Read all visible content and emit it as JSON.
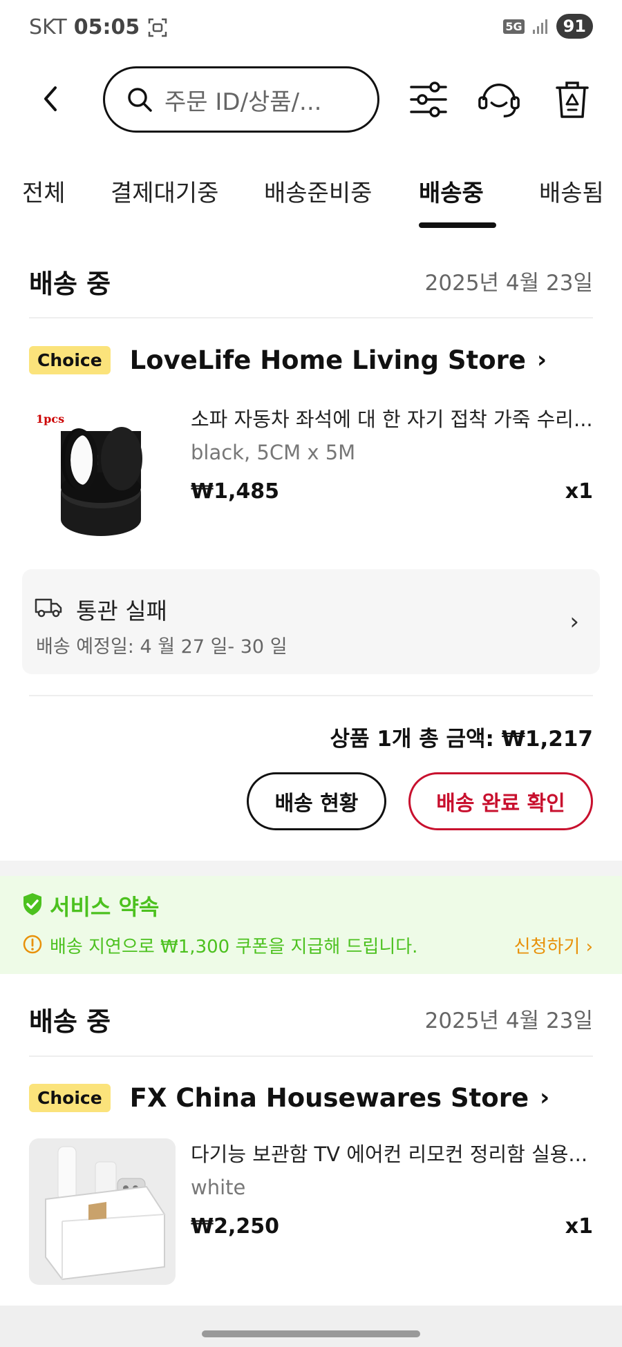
{
  "status_bar": {
    "carrier": "SKT",
    "time": "05:05",
    "network": "5G",
    "battery": "91"
  },
  "search": {
    "placeholder": "주문 ID/상품/..."
  },
  "tabs": [
    {
      "label": "전체"
    },
    {
      "label": "결제대기중"
    },
    {
      "label": "배송준비중"
    },
    {
      "label": "배송중"
    },
    {
      "label": "배송됨"
    }
  ],
  "orders": [
    {
      "status": "배송 중",
      "date": "2025년 4월 23일",
      "badge": "Choice",
      "store": "LoveLife Home Living Store",
      "product_title": "소파 자동차 좌석에 대 한 자기 접착 가죽 수리...",
      "variant": "black, 5CM x 5M",
      "price": "₩1,485",
      "qty": "x1",
      "thumb_label": "1pcs",
      "tracking_status": "통관 실패",
      "tracking_eta": "배송 예정일: 4 월 27 일- 30 일",
      "total": "상품 1개 총 금액: ₩1,217",
      "btn_track": "배송 현황",
      "btn_confirm": "배송 완료 확인"
    },
    {
      "status": "배송 중",
      "date": "2025년 4월 23일",
      "badge": "Choice",
      "store": "FX China Housewares Store",
      "product_title": "다기능 보관함 TV 에어컨 리모컨 정리함 실용...",
      "variant": "white",
      "price": "₩2,250",
      "qty": "x1"
    }
  ],
  "promise": {
    "title": "서비스 약속",
    "message": "배송 지연으로 ₩1,300 쿠폰을 지급해 드립니다.",
    "link": "신청하기 ›"
  },
  "colors": {
    "accent_red": "#c8102e",
    "choice_yellow": "#fbe37b",
    "promise_green": "#4cc11f",
    "link_orange": "#e8910a"
  }
}
